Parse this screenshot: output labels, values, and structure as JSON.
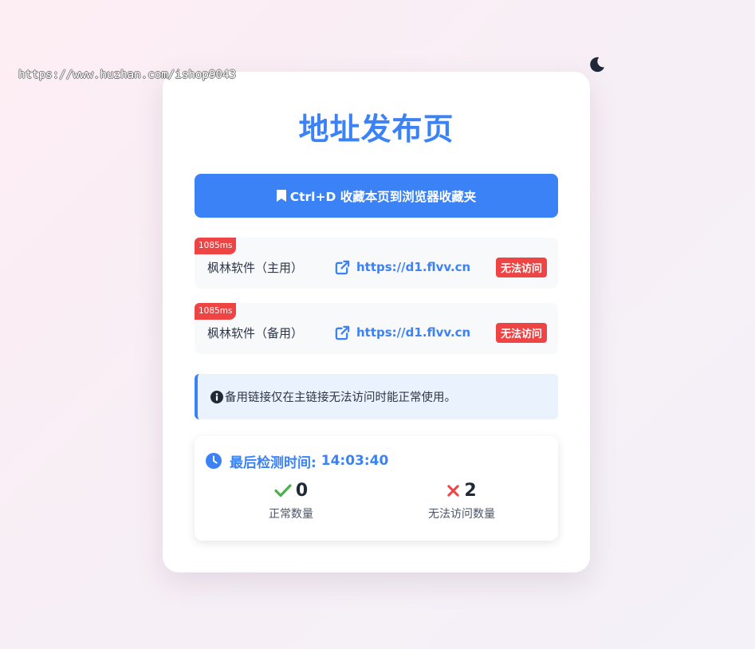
{
  "watermark": "https://www.huzhan.com/ishop9043",
  "theme_toggle": {
    "icon": "moon-icon"
  },
  "page": {
    "title": "地址发布页",
    "bookmark_label": "Ctrl+D 收藏本页到浏览器收藏夹"
  },
  "links": [
    {
      "latency": "1085ms",
      "name": "枫林软件（主用）",
      "url": "https://d1.flvv.cn",
      "status": "无法访问"
    },
    {
      "latency": "1085ms",
      "name": "枫林软件（备用）",
      "url": "https://d1.flvv.cn",
      "status": "无法访问"
    }
  ],
  "notice": {
    "text": "备用链接仅在主链接无法访问时能正常使用。"
  },
  "check": {
    "label": "最后检测时间:",
    "time": "14:03:40",
    "ok": {
      "value": "0",
      "label": "正常数量"
    },
    "fail": {
      "value": "2",
      "label": "无法访问数量"
    }
  },
  "colors": {
    "primary": "#3b82f6",
    "danger": "#ef4444",
    "success": "#4caf50",
    "card": "#ffffff"
  }
}
